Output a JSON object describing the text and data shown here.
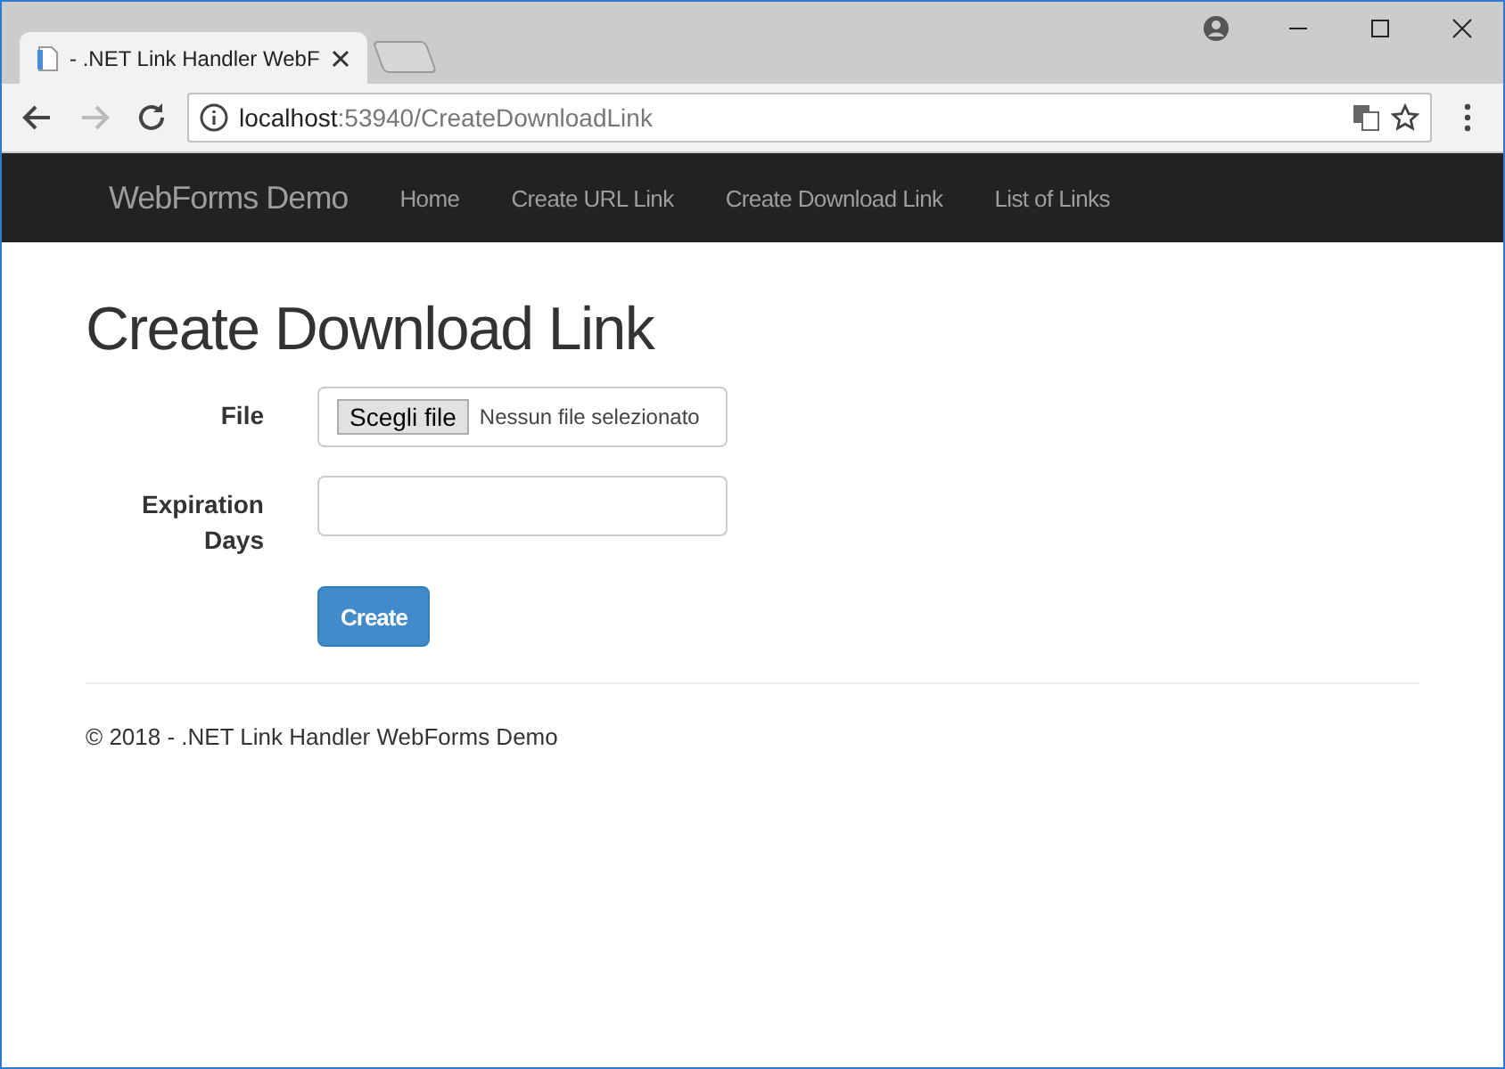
{
  "browser": {
    "tab_title": "- .NET Link Handler WebF",
    "url": {
      "host": "localhost",
      "path": ":53940/CreateDownloadLink"
    }
  },
  "navbar": {
    "brand": "WebForms Demo",
    "links": [
      "Home",
      "Create URL Link",
      "Create Download Link",
      "List of Links"
    ]
  },
  "page": {
    "heading": "Create Download Link",
    "file_field": {
      "label": "File",
      "button": "Scegli file",
      "status": "Nessun file selezionato"
    },
    "expiration_field": {
      "label": "Expiration Days"
    },
    "submit": "Create"
  },
  "footer": "© 2018 - .NET Link Handler WebForms Demo"
}
